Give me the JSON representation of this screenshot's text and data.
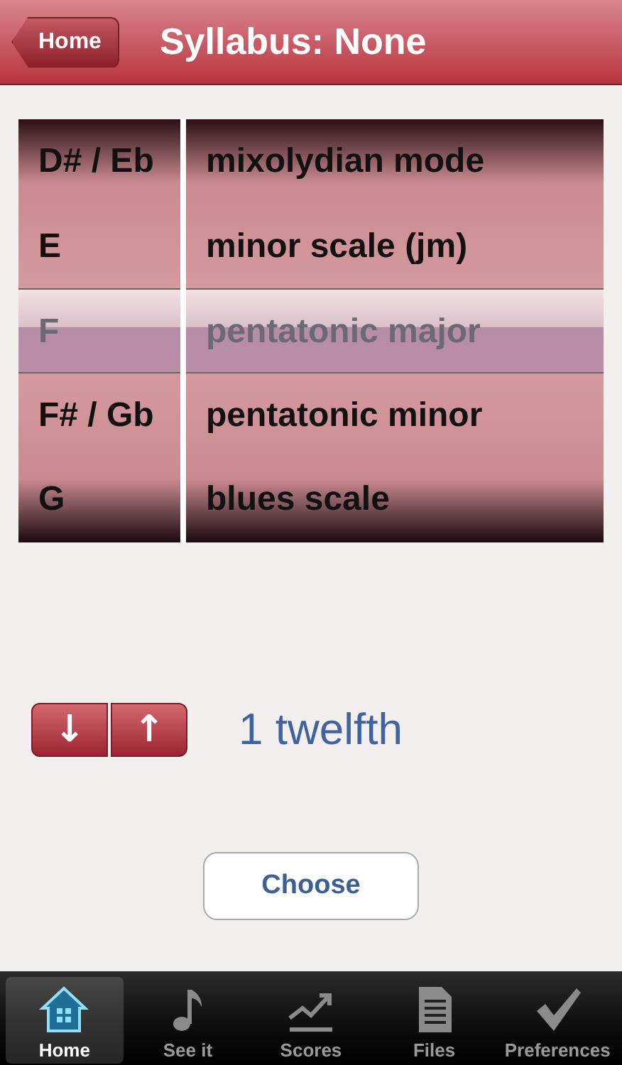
{
  "nav_bar": {
    "back_button": "Home",
    "title": "Syllabus: None"
  },
  "picker": {
    "columns": [
      {
        "items": [
          {
            "label": "D# / Eb",
            "selected": false
          },
          {
            "label": "E",
            "selected": false
          },
          {
            "label": "F",
            "selected": true
          },
          {
            "label": "F# / Gb",
            "selected": false
          },
          {
            "label": "G",
            "selected": false
          }
        ]
      },
      {
        "items": [
          {
            "label": "mixolydian mode",
            "selected": false
          },
          {
            "label": "minor scale (jm)",
            "selected": false
          },
          {
            "label": "pentatonic major",
            "selected": true
          },
          {
            "label": "pentatonic minor",
            "selected": false
          },
          {
            "label": "blues scale",
            "selected": false
          }
        ]
      }
    ]
  },
  "step_buttons": [
    {
      "label": "↓"
    },
    {
      "label": "↑"
    }
  ],
  "interval_label": "1 twelfth",
  "choose_button": "Choose",
  "tabs": [
    {
      "label": "Home",
      "kind": "home",
      "selected": true
    },
    {
      "label": "See it",
      "kind": "view",
      "selected": false
    },
    {
      "label": "Scores",
      "kind": "scores",
      "selected": false
    },
    {
      "label": "Files",
      "kind": "files",
      "selected": false
    },
    {
      "label": "Preferences",
      "kind": "preferences",
      "selected": false
    }
  ]
}
